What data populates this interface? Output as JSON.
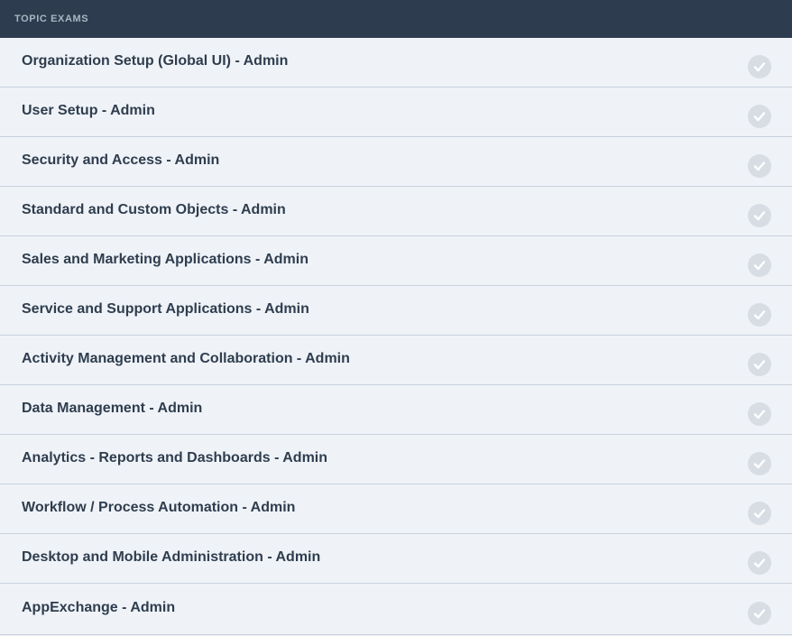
{
  "header": {
    "title": "TOPIC EXAMS"
  },
  "exams": [
    {
      "label": "Organization Setup (Global UI) - Admin",
      "status_icon": "check-circle-icon"
    },
    {
      "label": "User Setup - Admin",
      "status_icon": "check-circle-icon"
    },
    {
      "label": "Security and Access - Admin",
      "status_icon": "check-circle-icon"
    },
    {
      "label": "Standard and Custom Objects - Admin",
      "status_icon": "check-circle-icon"
    },
    {
      "label": "Sales and Marketing Applications - Admin",
      "status_icon": "check-circle-icon"
    },
    {
      "label": "Service and Support Applications - Admin",
      "status_icon": "check-circle-icon"
    },
    {
      "label": "Activity Management and Collaboration - Admin",
      "status_icon": "check-circle-icon"
    },
    {
      "label": "Data Management - Admin",
      "status_icon": "check-circle-icon"
    },
    {
      "label": "Analytics - Reports and Dashboards - Admin",
      "status_icon": "check-circle-icon"
    },
    {
      "label": "Workflow / Process Automation - Admin",
      "status_icon": "check-circle-icon"
    },
    {
      "label": "Desktop and Mobile Administration - Admin",
      "status_icon": "check-circle-icon"
    },
    {
      "label": "AppExchange - Admin",
      "status_icon": "check-circle-icon"
    }
  ],
  "colors": {
    "header_bg": "#2d3d4f",
    "header_text": "#aab5c2",
    "row_bg": "#eff3f8",
    "row_text": "#2f3d4e",
    "divider": "#c9d0dd",
    "check_bg": "#d8dde4",
    "check_mark": "#ffffff"
  }
}
